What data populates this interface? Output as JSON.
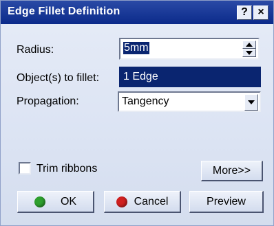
{
  "window": {
    "title": "Edge Fillet Definition"
  },
  "titlebar_buttons": {
    "help": "?",
    "close": "×"
  },
  "radius": {
    "label": "Radius:",
    "value": "5mm"
  },
  "objects": {
    "label": "Object(s) to fillet:",
    "value": "1 Edge"
  },
  "propagation": {
    "label": "Propagation:",
    "value": "Tangency"
  },
  "trim_ribbons": {
    "label": "Trim ribbons",
    "checked": false
  },
  "buttons": {
    "more": "More>>",
    "ok": "OK",
    "cancel": "Cancel",
    "preview": "Preview"
  },
  "colors": {
    "titlebar": "#0b2a8a",
    "selection": "#0a2570",
    "ok_dot": "#2ea02e",
    "cancel_dot": "#d02020"
  }
}
